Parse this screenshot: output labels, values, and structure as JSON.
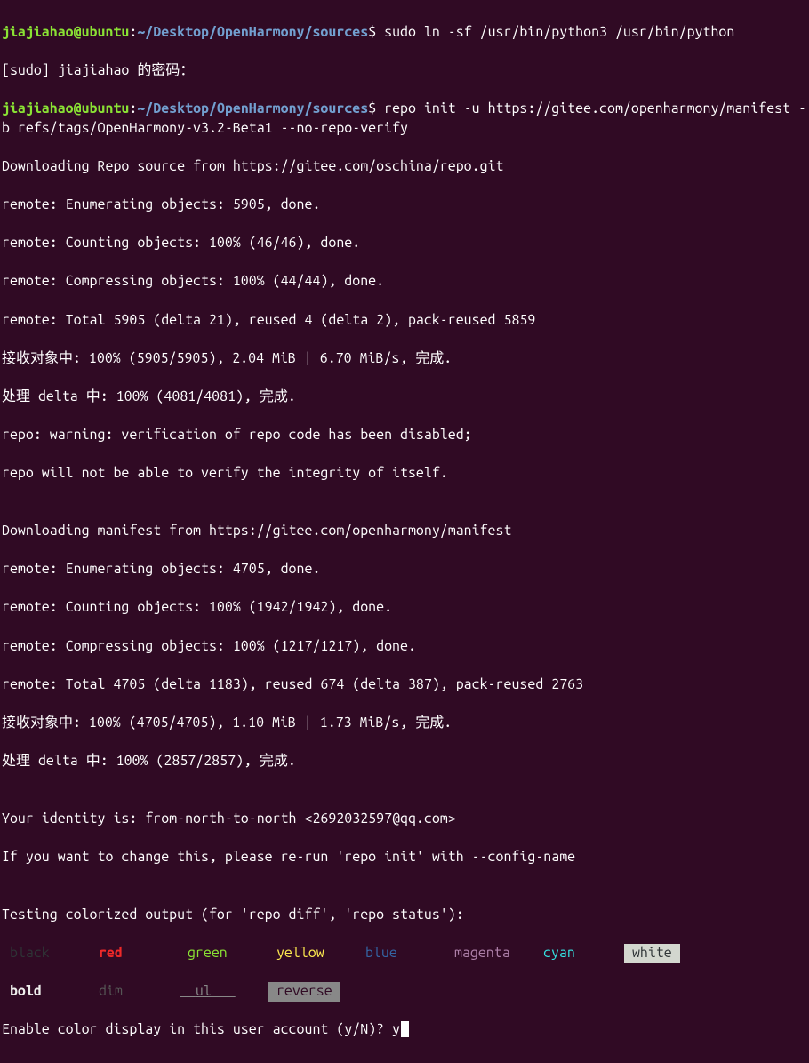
{
  "prompt1": {
    "user": "jiajiahao@ubuntu",
    "colon": ":",
    "path": "~/Desktop/OpenHarmony/sources",
    "dollar": "$ ",
    "cmd": "sudo ln -sf /usr/bin/python3 /usr/bin/python"
  },
  "sudo_line": "[sudo] jiajiahao 的密码：",
  "prompt2": {
    "user": "jiajiahao@ubuntu",
    "colon": ":",
    "path": "~/Desktop/OpenHarmony/sources",
    "dollar": "$ ",
    "cmd": "repo init -u https://gitee.com/openharmony/manifest -b refs/tags/OpenHarmony-v3.2-Beta1 --no-repo-verify"
  },
  "out": {
    "l1": "Downloading Repo source from https://gitee.com/oschina/repo.git",
    "l2": "remote: Enumerating objects: 5905, done.",
    "l3": "remote: Counting objects: 100% (46/46), done.",
    "l4": "remote: Compressing objects: 100% (44/44), done.",
    "l5": "remote: Total 5905 (delta 21), reused 4 (delta 2), pack-reused 5859",
    "l6": "接收对象中: 100% (5905/5905), 2.04 MiB | 6.70 MiB/s, 完成.",
    "l7": "处理 delta 中: 100% (4081/4081), 完成.",
    "l8": "repo: warning: verification of repo code has been disabled;",
    "l9": "repo will not be able to verify the integrity of itself.",
    "l10": "",
    "l11": "Downloading manifest from https://gitee.com/openharmony/manifest",
    "l12": "remote: Enumerating objects: 4705, done.",
    "l13": "remote: Counting objects: 100% (1942/1942), done.",
    "l14": "remote: Compressing objects: 100% (1217/1217), done.",
    "l15": "remote: Total 4705 (delta 1183), reused 674 (delta 387), pack-reused 2763",
    "l16": "接收对象中: 100% (4705/4705), 1.10 MiB | 1.73 MiB/s, 完成.",
    "l17": "处理 delta 中: 100% (2857/2857), 完成.",
    "l18": "",
    "l19": "Your identity is: from-north-to-north <2692032597@qq.com>",
    "l20": "If you want to change this, please re-run 'repo init' with --config-name",
    "l21": "",
    "l22": "Testing colorized output (for 'repo diff', 'repo status'):"
  },
  "colors": {
    "black": " black ",
    "red": " red  ",
    "green": " green ",
    "yellow": " yellow ",
    "blue": " blue ",
    "magenta": " magenta ",
    "cyan": " cyan ",
    "white": " white "
  },
  "styles": {
    "bold": " bold ",
    "dim": " dim ",
    "ul": "  ul   ",
    "reverse": " reverse "
  },
  "final": {
    "question": "Enable color display in this user account (y/N)? ",
    "answer": "y"
  }
}
